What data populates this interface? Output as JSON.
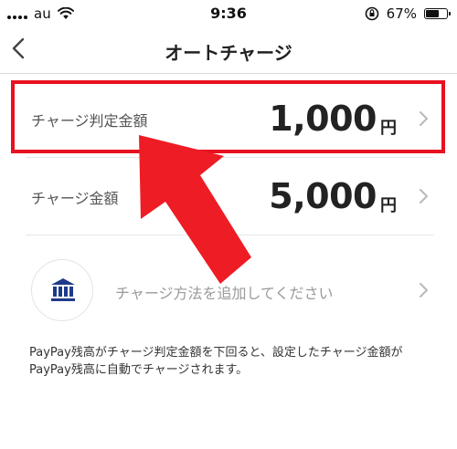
{
  "status_bar": {
    "carrier": "au",
    "time": "9:36",
    "battery_percent": "67%",
    "battery_level": 0.67
  },
  "header": {
    "title": "オートチャージ"
  },
  "rows": [
    {
      "label": "チャージ判定金額",
      "amount": "1,000",
      "unit": "円"
    },
    {
      "label": "チャージ金額",
      "amount": "5,000",
      "unit": "円"
    }
  ],
  "payment_method": {
    "label": "チャージ方法を追加してください"
  },
  "note": "PayPay残高がチャージ判定金額を下回ると、設定したチャージ金額がPayPay残高に自動でチャージされます。",
  "colors": {
    "highlight": "#e8111f",
    "bank_icon": "#1e3a8a"
  },
  "icons": [
    "wifi-icon",
    "orientation-lock-icon",
    "back-chevron-icon",
    "chevron-right-icon",
    "bank-icon",
    "arrow-annotation"
  ]
}
